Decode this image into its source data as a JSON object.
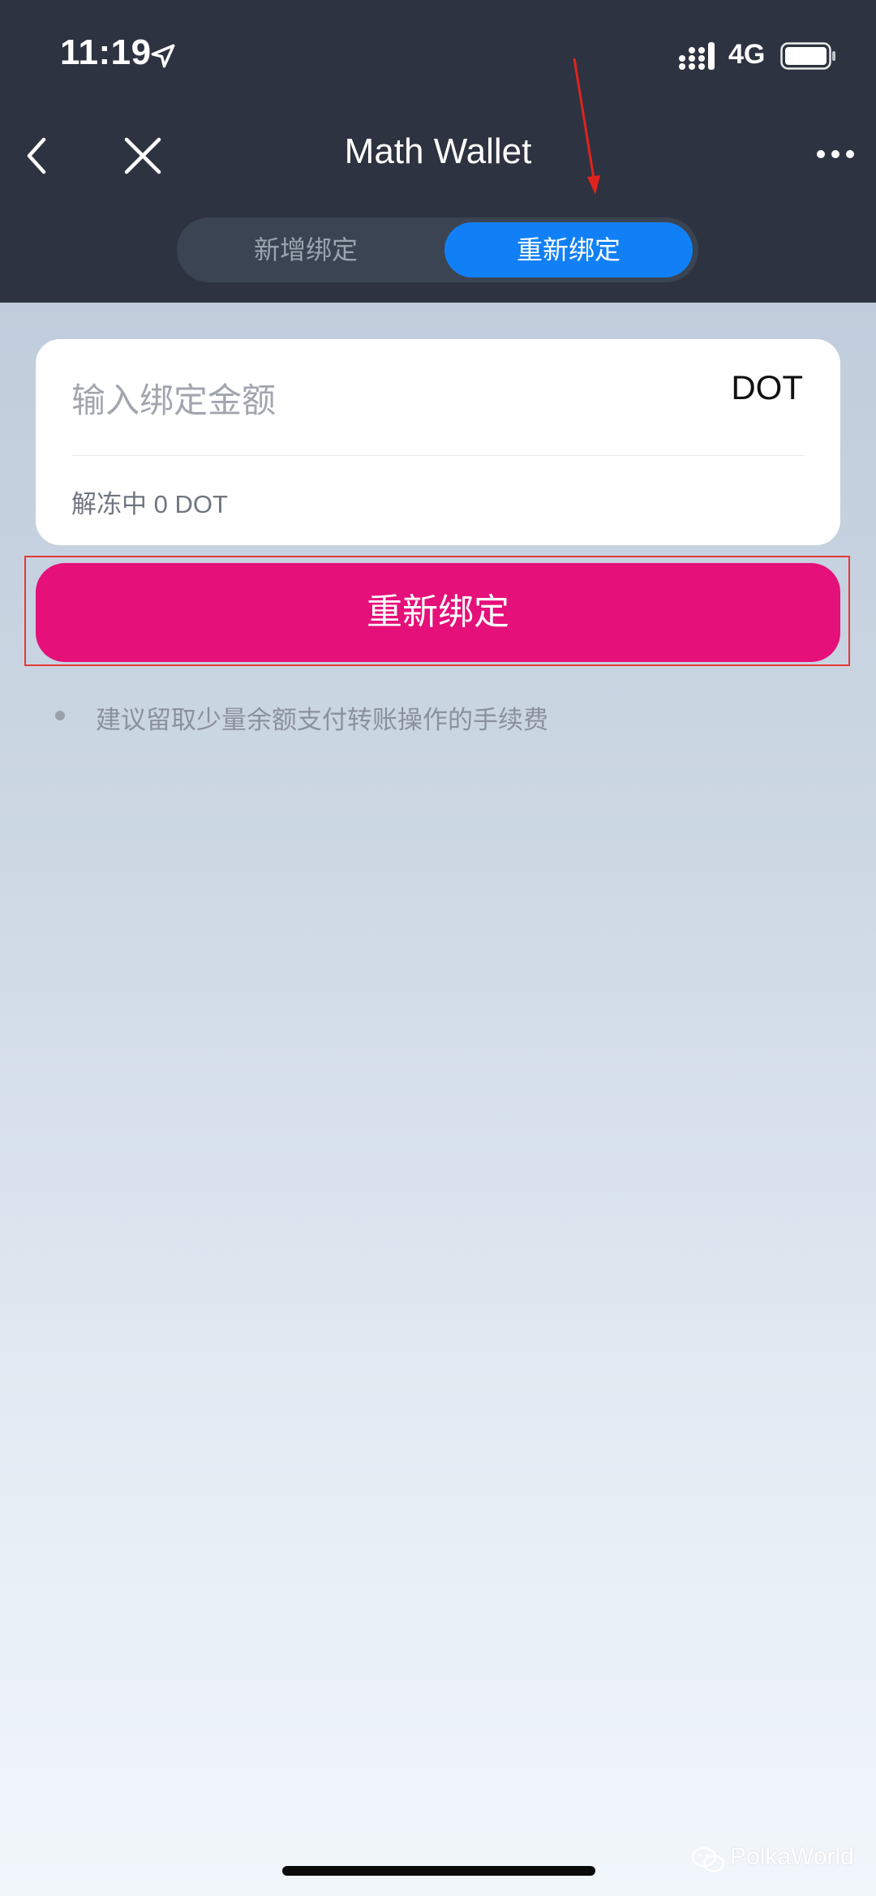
{
  "status_bar": {
    "time": "11:19",
    "network": "4G",
    "icons": [
      "location-arrow-icon",
      "signal-bars-icon",
      "battery-icon"
    ]
  },
  "nav": {
    "title": "Math Wallet",
    "icons": [
      "back-chevron-icon",
      "close-icon",
      "more-icon"
    ]
  },
  "tabs": {
    "items": [
      {
        "label": "新增绑定",
        "active": false
      },
      {
        "label": "重新绑定",
        "active": true
      }
    ],
    "active_color": "#1180f6"
  },
  "form": {
    "amount_placeholder": "输入绑定金额",
    "amount_value": "",
    "unit": "DOT",
    "unbonding_text": "解冻中 0 DOT"
  },
  "action": {
    "button_label": "重新绑定",
    "button_color": "#e5107a"
  },
  "tips": [
    "建议留取少量余额支付转账操作的手续费"
  ],
  "watermark": {
    "text": "PolkaWorld"
  }
}
